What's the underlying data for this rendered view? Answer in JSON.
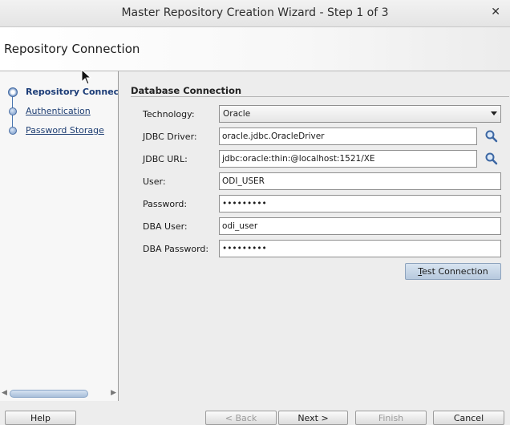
{
  "window": {
    "title": "Master Repository Creation Wizard - Step 1 of 3",
    "close_glyph": "✕"
  },
  "header": {
    "title": "Repository Connection"
  },
  "steps": [
    {
      "label": "Repository Connection",
      "state": "current"
    },
    {
      "label": "Authentication",
      "state": "pending"
    },
    {
      "label": "Password Storage",
      "state": "pending"
    }
  ],
  "form": {
    "section_title": "Database Connection",
    "technology": {
      "label": "Technology:",
      "value": "Oracle"
    },
    "jdbc_driver": {
      "label": "JDBC Driver:",
      "value": "oracle.jdbc.OracleDriver"
    },
    "jdbc_url": {
      "label": "JDBC URL:",
      "value": "jdbc:oracle:thin:@localhost:1521/XE"
    },
    "user": {
      "label": "User:",
      "value": "ODI_USER"
    },
    "password": {
      "label": "Password:",
      "value": "•••••••••"
    },
    "dba_user": {
      "label": "DBA User:",
      "value": "odi_user"
    },
    "dba_password": {
      "label": "DBA Password:",
      "value": "•••••••••"
    },
    "test_button": {
      "mnemonic": "T",
      "rest": "est Connection"
    }
  },
  "buttons": {
    "help": "Help",
    "back": "< Back",
    "next": "Next >",
    "finish": "Finish",
    "cancel": "Cancel"
  },
  "colors": {
    "accent": "#4a6ea4",
    "link": "#1f3f73"
  }
}
